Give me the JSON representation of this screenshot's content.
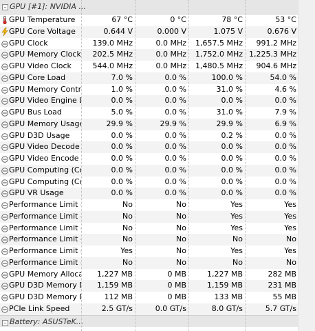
{
  "group": {
    "title": "GPU [#1]: NVIDIA ..."
  },
  "next_group": {
    "title": "Battery: ASUSTeK..."
  },
  "colors": {
    "alt_row": "#f3f3f3",
    "header_bg": "#e6e6e6",
    "thermo_red": "#d9302c",
    "bolt_yellow": "#f2b705"
  },
  "rows": [
    {
      "icon": "thermometer-icon",
      "label": "GPU Temperature",
      "values": [
        "67 °C",
        "0 °C",
        "78 °C",
        "53 °C"
      ]
    },
    {
      "icon": "lightning-bolt-icon",
      "label": "GPU Core Voltage",
      "values": [
        "0.644 V",
        "0.000 V",
        "1.075 V",
        "0.676 V"
      ]
    },
    {
      "icon": "clock-gauge-icon",
      "label": "GPU Clock",
      "values": [
        "139.0 MHz",
        "0.0 MHz",
        "1,657.5 MHz",
        "991.2 MHz"
      ]
    },
    {
      "icon": "clock-gauge-icon",
      "label": "GPU Memory Clock",
      "values": [
        "202.5 MHz",
        "0.0 MHz",
        "1,752.0 MHz",
        "1,225.3 MHz"
      ]
    },
    {
      "icon": "clock-gauge-icon",
      "label": "GPU Video Clock",
      "values": [
        "544.0 MHz",
        "0.0 MHz",
        "1,480.5 MHz",
        "904.6 MHz"
      ]
    },
    {
      "icon": "gauge-icon",
      "label": "GPU Core Load",
      "values": [
        "7.0 %",
        "0.0 %",
        "100.0 %",
        "54.0 %"
      ]
    },
    {
      "icon": "gauge-icon",
      "label": "GPU Memory Contr...",
      "values": [
        "1.0 %",
        "0.0 %",
        "31.0 %",
        "4.6 %"
      ]
    },
    {
      "icon": "gauge-icon",
      "label": "GPU Video Engine L...",
      "values": [
        "0.0 %",
        "0.0 %",
        "0.0 %",
        "0.0 %"
      ]
    },
    {
      "icon": "gauge-icon",
      "label": "GPU Bus Load",
      "values": [
        "5.0 %",
        "0.0 %",
        "31.0 %",
        "7.9 %"
      ]
    },
    {
      "icon": "gauge-icon",
      "label": "GPU Memory Usage",
      "values": [
        "29.9 %",
        "29.9 %",
        "29.9 %",
        "6.9 %"
      ]
    },
    {
      "icon": "gauge-icon",
      "label": "GPU D3D Usage",
      "values": [
        "0.0 %",
        "0.0 %",
        "0.2 %",
        "0.0 %"
      ]
    },
    {
      "icon": "gauge-icon",
      "label": "GPU Video Decode ...",
      "values": [
        "0.0 %",
        "0.0 %",
        "0.0 %",
        "0.0 %"
      ]
    },
    {
      "icon": "gauge-icon",
      "label": "GPU Video Encode ...",
      "values": [
        "0.0 %",
        "0.0 %",
        "0.0 %",
        "0.0 %"
      ]
    },
    {
      "icon": "gauge-icon",
      "label": "GPU Computing (Co...",
      "values": [
        "0.0 %",
        "0.0 %",
        "0.0 %",
        "0.0 %"
      ]
    },
    {
      "icon": "gauge-icon",
      "label": "GPU Computing (Co...",
      "values": [
        "0.0 %",
        "0.0 %",
        "0.0 %",
        "0.0 %"
      ]
    },
    {
      "icon": "gauge-icon",
      "label": "GPU VR Usage",
      "values": [
        "0.0 %",
        "0.0 %",
        "0.0 %",
        "0.0 %"
      ]
    },
    {
      "icon": "gauge-icon",
      "label": "Performance Limit - ...",
      "values": [
        "No",
        "No",
        "Yes",
        "Yes"
      ]
    },
    {
      "icon": "gauge-icon",
      "label": "Performance Limit - ...",
      "values": [
        "No",
        "No",
        "Yes",
        "Yes"
      ]
    },
    {
      "icon": "gauge-icon",
      "label": "Performance Limit - ...",
      "values": [
        "No",
        "No",
        "Yes",
        "Yes"
      ]
    },
    {
      "icon": "gauge-icon",
      "label": "Performance Limit - ...",
      "values": [
        "No",
        "No",
        "No",
        "No"
      ]
    },
    {
      "icon": "gauge-icon",
      "label": "Performance Limit - ...",
      "values": [
        "Yes",
        "No",
        "Yes",
        "Yes"
      ]
    },
    {
      "icon": "gauge-icon",
      "label": "Performance Limit - ...",
      "values": [
        "No",
        "No",
        "No",
        "No"
      ]
    },
    {
      "icon": "gauge-icon",
      "label": "GPU Memory Alloca...",
      "values": [
        "1,227 MB",
        "0 MB",
        "1,227 MB",
        "282 MB"
      ]
    },
    {
      "icon": "gauge-icon",
      "label": "GPU D3D Memory D...",
      "values": [
        "1,159 MB",
        "0 MB",
        "1,159 MB",
        "231 MB"
      ]
    },
    {
      "icon": "gauge-icon",
      "label": "GPU D3D Memory D...",
      "values": [
        "112 MB",
        "0 MB",
        "133 MB",
        "55 MB"
      ]
    },
    {
      "icon": "gauge-icon",
      "label": "PCIe Link Speed",
      "values": [
        "2.5 GT/s",
        "0.0 GT/s",
        "8.0 GT/s",
        "5.7 GT/s"
      ]
    }
  ]
}
